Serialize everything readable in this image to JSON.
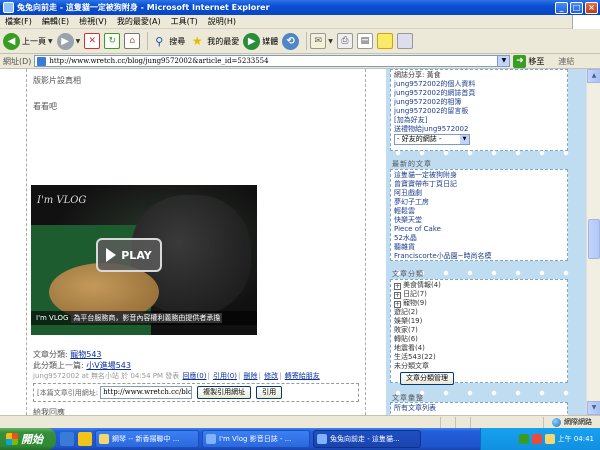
{
  "window": {
    "title": "兔兔向前走 - 這隻貓一定被狗附身 - Microsoft Internet Explorer"
  },
  "menu": [
    "檔案(F)",
    "編輯(E)",
    "檢視(V)",
    "我的最愛(A)",
    "工具(T)",
    "說明(H)"
  ],
  "toolbar": {
    "back": "上一頁",
    "search": "搜尋",
    "favorites": "我的最愛",
    "media": "媒體"
  },
  "address": {
    "label": "網址(D)",
    "url": "http://www.wretch.cc/blog/jung9572002&article_id=5233554",
    "go": "移至",
    "links": "連結"
  },
  "article": {
    "line1": "版影片設真相",
    "line2": "看看吧",
    "video": {
      "watermark": "I'm VLOG",
      "play": "PLAY",
      "vlog": "I'm VLOG",
      "notice": "為平台服務商，影音內容權利義務由提供者承擔"
    },
    "category_label": "文章分類:",
    "category_link": "寵物543",
    "prev_label": "此分類上一篇:",
    "prev_link": "小V進場543",
    "meta_user": "jung9572002 at",
    "meta_time": "無名小站 於 04:54 PM 發表",
    "meta_links": [
      "回應(0)",
      "引用(0)",
      "刪除",
      "修改",
      "轉寄給朋友"
    ],
    "trackback_label": "[本篇文章引用網址:",
    "trackback_url": "http://www.wretch.cc/blog/",
    "copy_btn": "複製引用網址",
    "cite_btn": "引用",
    "footer_line": "給我回應"
  },
  "sidebar": {
    "profile_items": [
      "網誌分享: 黃食",
      "jung9572002的個人資料",
      "jung9572002的網誌首頁",
      "jung9572002的相簿",
      "jung9572002的留言板",
      "[加為好友]",
      "送禮物給jung9572002"
    ],
    "friends_select": "- 好友的網誌 -",
    "recent_head": "最新的文章",
    "recent": [
      "這隻貓一定被狗附身",
      "曾寶寶帶布丁頁日記",
      "阿丑戲劇",
      "夢幻子工房",
      "輕鬆雲",
      "快樂天堂",
      "Piece of Cake",
      "52水晶",
      "聽雜貨",
      "Franciscorte小品園~時尚名模"
    ],
    "categories_head": "文章分類",
    "categories": [
      "美食情報(4)",
      "日記(7)",
      "寵物(9)",
      "遊記(2)",
      "娛樂(19)",
      "敗家(7)",
      "轉貼(6)",
      "地震看(4)",
      "生活543(22)",
      "未分類文章"
    ],
    "manage_btn": "文章分類管理",
    "archive_head": "文章彙整",
    "archive_item": "所有文章列表"
  },
  "status": {
    "zone": "網際網路"
  },
  "taskbar": {
    "start": "開始",
    "tasks": [
      "鋼琴 -- 新香揚聯中 ...",
      "I'm Vlog 影音日誌 - ...",
      "兔兔向前走 - 這隻貓..."
    ],
    "clock": "上午 04:41"
  }
}
